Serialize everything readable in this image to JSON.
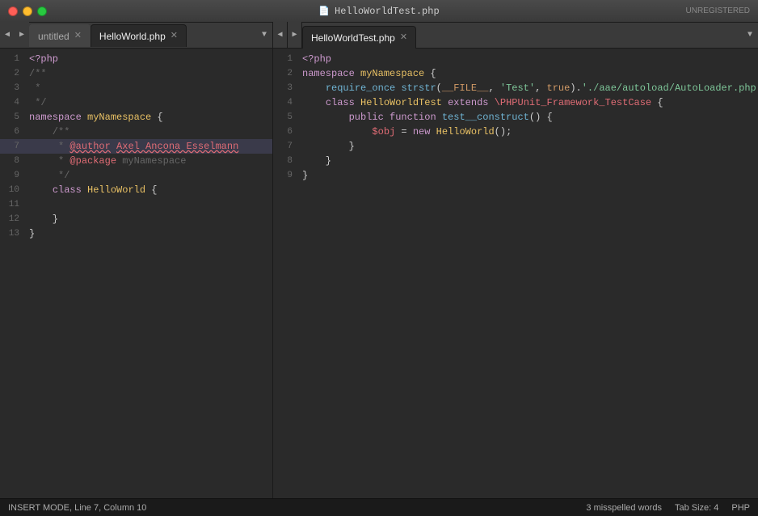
{
  "titlebar": {
    "title": "HelloWorldTest.php",
    "unregistered": "UNREGISTERED"
  },
  "tabs_left": {
    "nav_prev": "◀",
    "nav_next": "▶",
    "tab1": {
      "label": "untitled",
      "active": false
    },
    "tab2": {
      "label": "HelloWorld.php",
      "active": true
    },
    "dropdown": "▼"
  },
  "tabs_right": {
    "nav_prev": "◀",
    "nav_next": "▶",
    "tab1": {
      "label": "HelloWorldTest.php",
      "active": true
    },
    "dropdown": "▼"
  },
  "left_code": [
    {
      "num": 1,
      "content": "<?php"
    },
    {
      "num": 2,
      "content": "/**"
    },
    {
      "num": 3,
      "content": " *"
    },
    {
      "num": 4,
      "content": " */"
    },
    {
      "num": 5,
      "content": "namespace myNamespace {"
    },
    {
      "num": 6,
      "content": "    /**"
    },
    {
      "num": 7,
      "content": "     * @author Axel Ancona Esselmann"
    },
    {
      "num": 8,
      "content": "     * @package myNamespace"
    },
    {
      "num": 9,
      "content": "     */"
    },
    {
      "num": 10,
      "content": "    class HelloWorld {"
    },
    {
      "num": 11,
      "content": ""
    },
    {
      "num": 12,
      "content": "    }"
    },
    {
      "num": 13,
      "content": "}"
    }
  ],
  "right_code": [
    {
      "num": 1,
      "content": "<?php"
    },
    {
      "num": 2,
      "content": "namespace myNamespace {"
    },
    {
      "num": 3,
      "content": "    require_once strstr(__FILE__, 'Test', true).'/aae/autoload/AutoLoader.php';"
    },
    {
      "num": 4,
      "content": "    class HelloWorldTest extends \\PHPUnit_Framework_TestCase {"
    },
    {
      "num": 5,
      "content": "        public function test__construct() {"
    },
    {
      "num": 6,
      "content": ""
    },
    {
      "num": 7,
      "content": "        }"
    },
    {
      "num": 8,
      "content": "    }"
    },
    {
      "num": 9,
      "content": "}"
    }
  ],
  "statusbar": {
    "mode": "INSERT MODE, Line 7, Column 10",
    "spellcheck": "3 misspelled words",
    "tabsize": "Tab Size: 4",
    "language": "PHP"
  }
}
